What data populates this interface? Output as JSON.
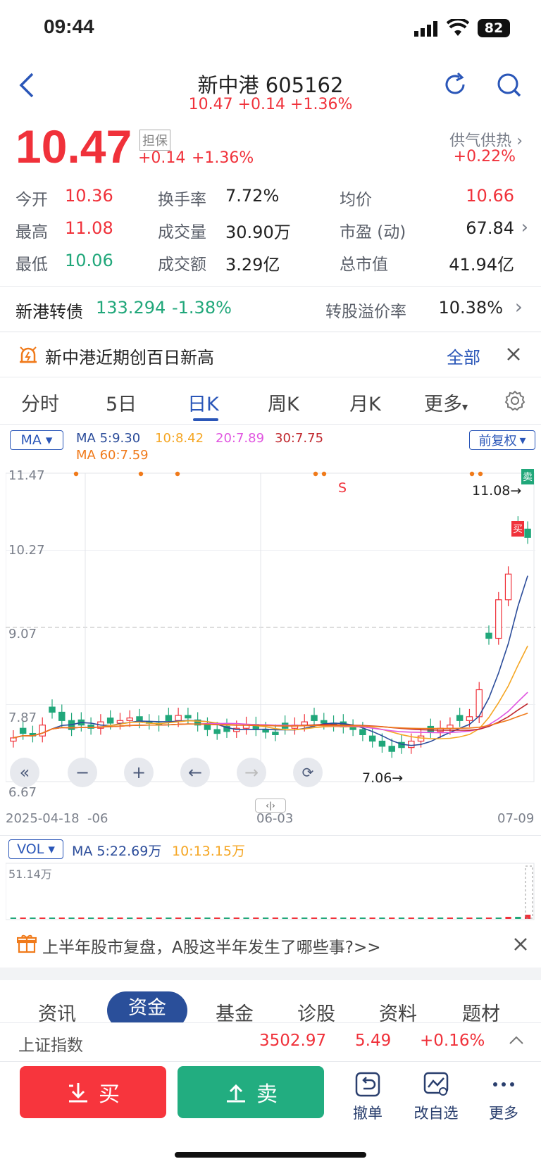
{
  "status": {
    "time": "09:44",
    "battery": "82"
  },
  "header": {
    "title": "新中港 605162",
    "subtitle": "10.47 +0.14 +1.36%"
  },
  "quote": {
    "price": "10.47",
    "tag": "担保",
    "change": "+0.14",
    "change_pct": "+1.36%",
    "sector_name": "供气供热",
    "sector_change": "+0.22%"
  },
  "stats": {
    "open_label": "今开",
    "open": "10.36",
    "high_label": "最高",
    "high": "11.08",
    "low_label": "最低",
    "low": "10.06",
    "turnover_label": "换手率",
    "turnover": "7.72%",
    "volume_label": "成交量",
    "volume": "30.90万",
    "amount_label": "成交额",
    "amount": "3.29亿",
    "avg_label": "均价",
    "avg": "10.66",
    "pe_label": "市盈 (动)",
    "pe": "67.84",
    "mcap_label": "总市值",
    "mcap": "41.94亿"
  },
  "bond": {
    "name": "新港转债",
    "price": "133.294",
    "change": "-1.38%",
    "premium_label": "转股溢价率",
    "premium": "10.38%"
  },
  "notice": {
    "text": "新中港近期创百日新高",
    "link": "全部"
  },
  "chart_tabs": [
    "分时",
    "5日",
    "日K",
    "周K",
    "月K",
    "更多"
  ],
  "active_tab": "日K",
  "ma": {
    "selector": "MA",
    "ma5": "MA 5:9.30",
    "ma10": "10:8.42",
    "ma20": "20:7.89",
    "ma30": "30:7.75",
    "ma60": "MA 60:7.59",
    "adjust": "前复权"
  },
  "chart_data": {
    "type": "candlestick",
    "y_ticks": [
      "11.47",
      "10.27",
      "9.07",
      "7.87",
      "6.67"
    ],
    "x_ticks": [
      "2025-04-18",
      "-06",
      "06-03",
      "07-09"
    ],
    "ylim": [
      6.67,
      11.47
    ],
    "high_marker": "11.08→",
    "low_marker": "7.06→",
    "signal_s": "S",
    "sell_flag": "卖",
    "buy_flag": "买",
    "closes": [
      7.35,
      7.42,
      7.38,
      7.55,
      7.75,
      7.62,
      7.48,
      7.55,
      7.5,
      7.6,
      7.58,
      7.62,
      7.66,
      7.6,
      7.58,
      7.55,
      7.62,
      7.7,
      7.66,
      7.55,
      7.48,
      7.42,
      7.45,
      7.5,
      7.56,
      7.48,
      7.44,
      7.4,
      7.5,
      7.55,
      7.6,
      7.62,
      7.58,
      7.55,
      7.52,
      7.48,
      7.4,
      7.3,
      7.22,
      7.14,
      7.2,
      7.3,
      7.38,
      7.45,
      7.5,
      7.55,
      7.62,
      7.68,
      8.1,
      8.9,
      9.5,
      9.9,
      10.6,
      10.47
    ],
    "colors": {
      "up": "#f0313a",
      "down": "#20a77a",
      "ma5": "#2b4c9a",
      "ma10": "#f5a623",
      "ma20": "#e055e0",
      "ma30": "#c0282e",
      "ma60": "#f07a1a"
    }
  },
  "vol": {
    "selector": "VOL",
    "ma5": "MA 5:22.69万",
    "ma10": "10:13.15万",
    "max": "51.14万"
  },
  "banner": {
    "text": "上半年股市复盘，A股这半年发生了哪些事?>>"
  },
  "info_tabs": [
    "资讯",
    "资金",
    "基金",
    "诊股",
    "资料",
    "题材"
  ],
  "info_active": "资金",
  "index": {
    "name": "上证指数",
    "value": "3502.97",
    "change": "5.49",
    "pct": "+0.16%"
  },
  "actions": {
    "buy": "买",
    "sell": "卖",
    "cancel": "撤单",
    "watch": "改自选",
    "more": "更多"
  }
}
